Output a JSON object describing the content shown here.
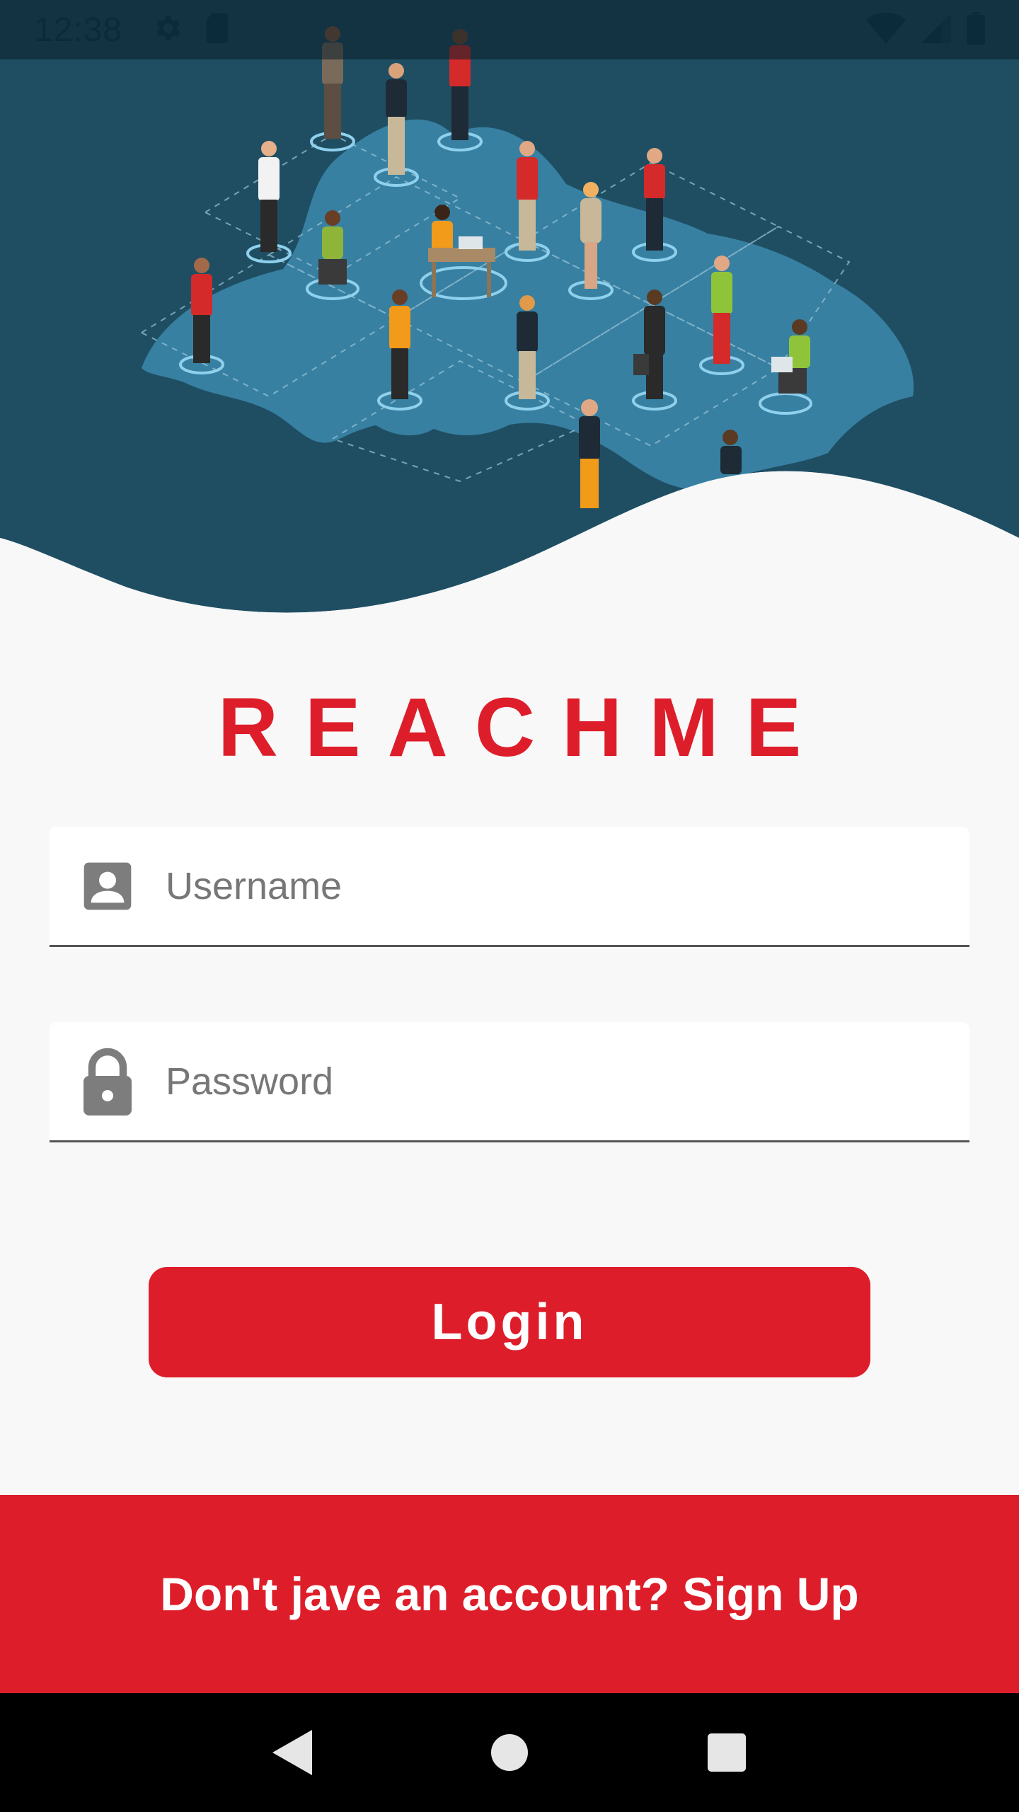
{
  "status_bar": {
    "time": "12:38",
    "left_icons": [
      "settings-icon",
      "sd-card-icon"
    ],
    "right_icons": [
      "wifi-icon",
      "cell-signal-icon",
      "battery-icon"
    ]
  },
  "hero": {
    "background_color": "#1f4e63",
    "map_color": "#3a86a8"
  },
  "brand": {
    "name": "REACHME",
    "color": "#dd1e2a"
  },
  "form": {
    "username": {
      "placeholder": "Username",
      "value": "",
      "icon": "account-box-icon"
    },
    "password": {
      "placeholder": "Password",
      "value": "",
      "icon": "lock-icon"
    }
  },
  "login_button": {
    "label": "Login",
    "color": "#dd1e2a"
  },
  "signup": {
    "text": "Don't jave an account? Sign Up"
  },
  "nav_bar": {
    "buttons": [
      "back-icon",
      "home-icon",
      "recents-icon"
    ]
  }
}
